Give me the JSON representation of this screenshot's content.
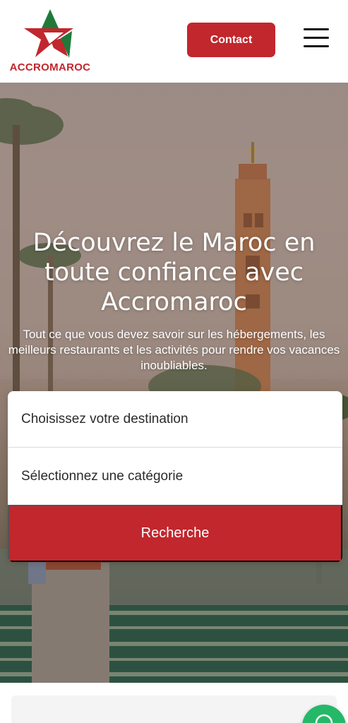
{
  "header": {
    "logo_text": "ACCROMAROC",
    "contact_label": "Contact"
  },
  "hero": {
    "title": "Découvrez le Maroc en toute confiance avec Accromaroc",
    "subtitle": "Tout ce que vous devez savoir sur les hébergements, les meilleurs restaurants et les activités pour rendre vos vacances inoubliables."
  },
  "search": {
    "destination_placeholder": "Choisissez votre destination",
    "category_placeholder": "Sélectionnez une catégorie",
    "button_label": "Recherche"
  },
  "colors": {
    "brand_red": "#c1272d",
    "brand_green": "#1f7a3a",
    "chat_green": "#25b868"
  },
  "icons": {
    "menu": "hamburger-menu-icon",
    "chat": "whatsapp-chat-icon"
  }
}
